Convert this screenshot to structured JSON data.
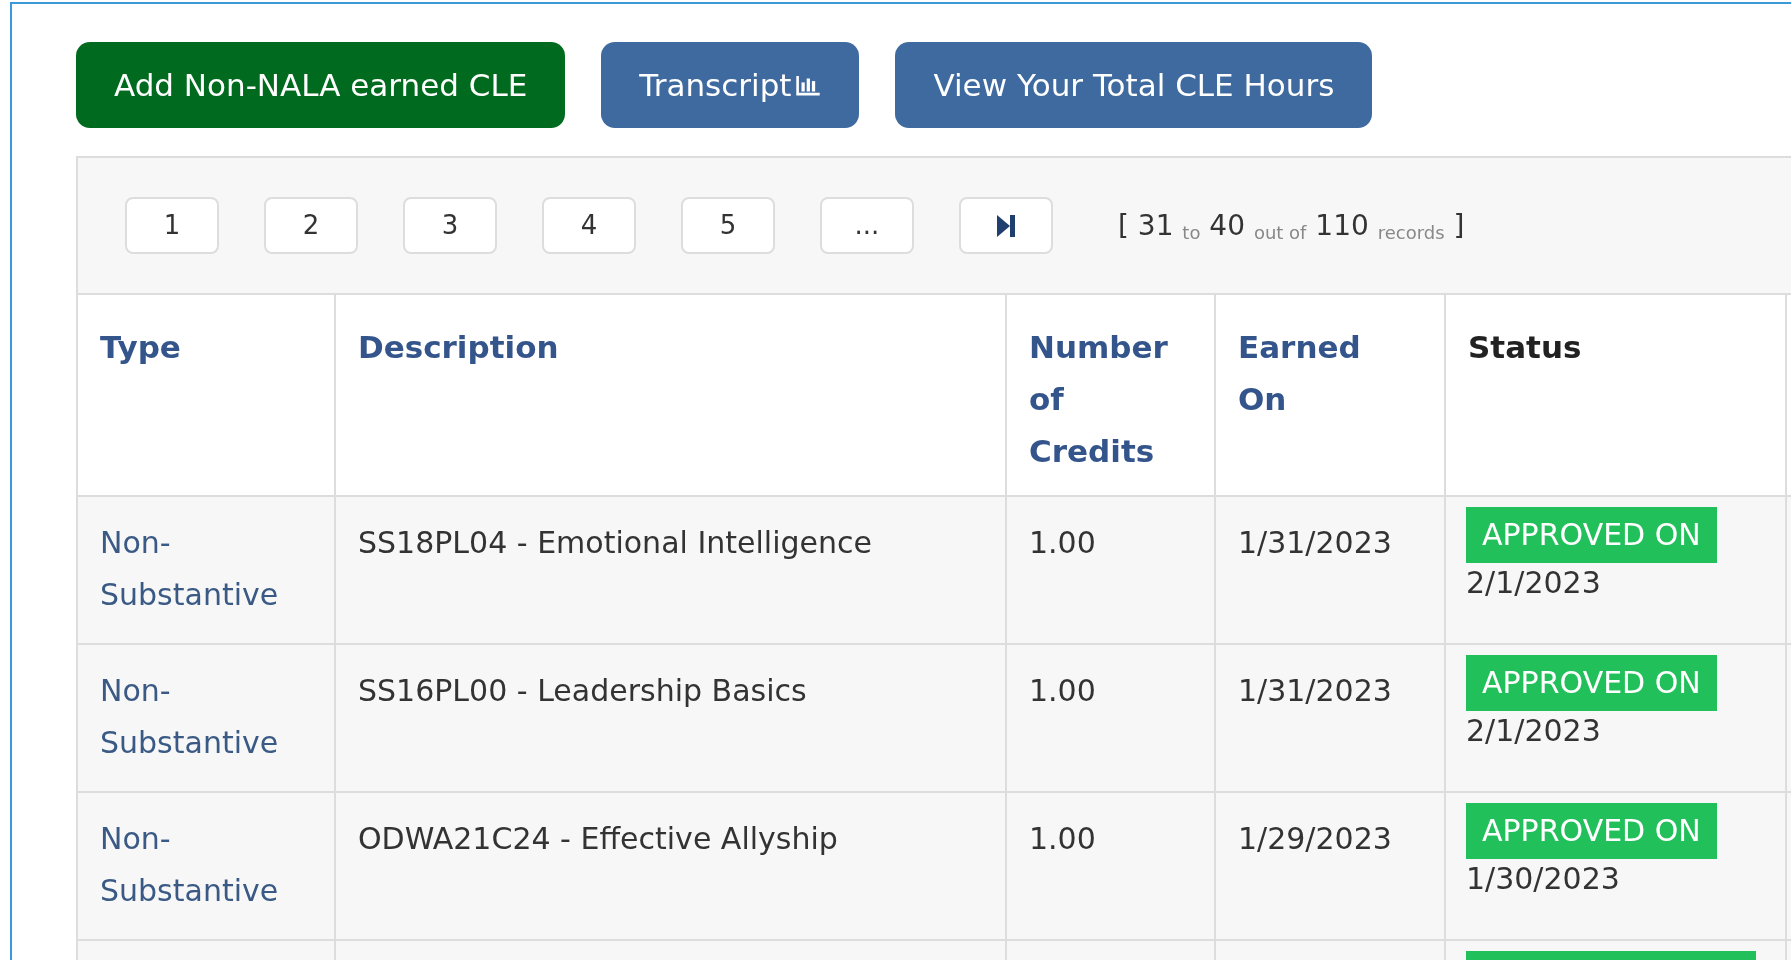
{
  "actions": [
    {
      "label": "Add Non-NALA earned CLE",
      "kind": "primary",
      "icon": false
    },
    {
      "label": "Transcript",
      "kind": "secondary",
      "icon": true
    },
    {
      "label": "View Your Total CLE Hours",
      "kind": "secondary",
      "icon": false
    }
  ],
  "pagination": {
    "pages": [
      {
        "label": "1",
        "kind": "page"
      },
      {
        "label": "2",
        "kind": "page"
      },
      {
        "label": "3",
        "kind": "page"
      },
      {
        "label": "4",
        "kind": "page"
      },
      {
        "label": "5",
        "kind": "page"
      },
      {
        "label": "...",
        "kind": "page"
      },
      {
        "kind": "last"
      }
    ],
    "summary": "[ 31 $_{to}$ 40 $_{out of}$ 110 $_{records}$ ]"
  },
  "table": {
    "columns": [
      {
        "label": "Type",
        "color": "#34558b"
      },
      {
        "label": "Description",
        "color": "#34558b"
      },
      {
        "label": "Number of Credits",
        "color": "#34558b"
      },
      {
        "label": "Earned On",
        "color": "#34558b"
      },
      {
        "label": "Status",
        "color": "#222222"
      }
    ],
    "rows": [
      {
        "type": "Non-Substantive",
        "description": "SS18PL04 - Emotional Intelligence",
        "credits": "1.00",
        "earned_on": "1/31/2023",
        "status": "APPROVED ON",
        "color": "#22c05a",
        "status_date": "2/1/2023"
      },
      {
        "type": "Non-Substantive",
        "description": "SS16PL00 - Leadership Basics",
        "credits": "1.00",
        "earned_on": "1/31/2023",
        "status": "APPROVED ON",
        "color": "#22c05a",
        "status_date": "2/1/2023"
      },
      {
        "type": "Non-Substantive",
        "description": "ODWA21C24 - Effective Allyship",
        "credits": "1.00",
        "earned_on": "1/29/2023",
        "status": "APPROVED ON",
        "color": "#22c05a",
        "status_date": "1/30/2023"
      },
      {
        "color": "#22c05a"
      }
    ]
  }
}
